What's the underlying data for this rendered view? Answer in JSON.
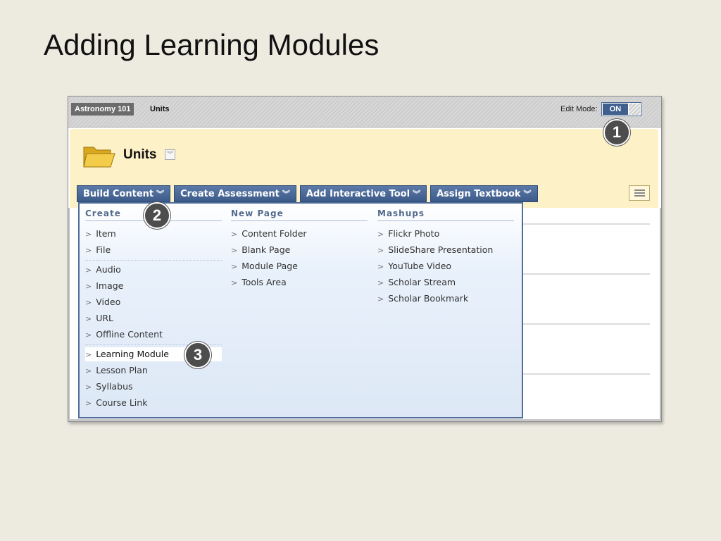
{
  "slide": {
    "title": "Adding Learning Modules"
  },
  "topbar": {
    "course": "Astronomy 101",
    "page": "Units",
    "edit_mode_label": "Edit Mode:",
    "edit_mode_value": "ON"
  },
  "header": {
    "title": "Units"
  },
  "actions": [
    {
      "label": "Build Content"
    },
    {
      "label": "Create Assessment"
    },
    {
      "label": "Add Interactive Tool"
    },
    {
      "label": "Assign Textbook"
    }
  ],
  "menu": {
    "create": {
      "heading": "Create",
      "items": [
        "Item",
        "File",
        "Audio",
        "Image",
        "Video",
        "URL",
        "Offline Content",
        "Learning Module",
        "Lesson Plan",
        "Syllabus",
        "Course Link"
      ]
    },
    "new_page": {
      "heading": "New Page",
      "items": [
        "Content Folder",
        "Blank Page",
        "Module Page",
        "Tools Area"
      ]
    },
    "mashups": {
      "heading": "Mashups",
      "items": [
        "Flickr Photo",
        "SlideShare Presentation",
        "YouTube Video",
        "Scholar Stream",
        "Scholar Bookmark"
      ]
    },
    "selected_item": "Learning Module"
  },
  "callouts": [
    "1",
    "2",
    "3"
  ]
}
